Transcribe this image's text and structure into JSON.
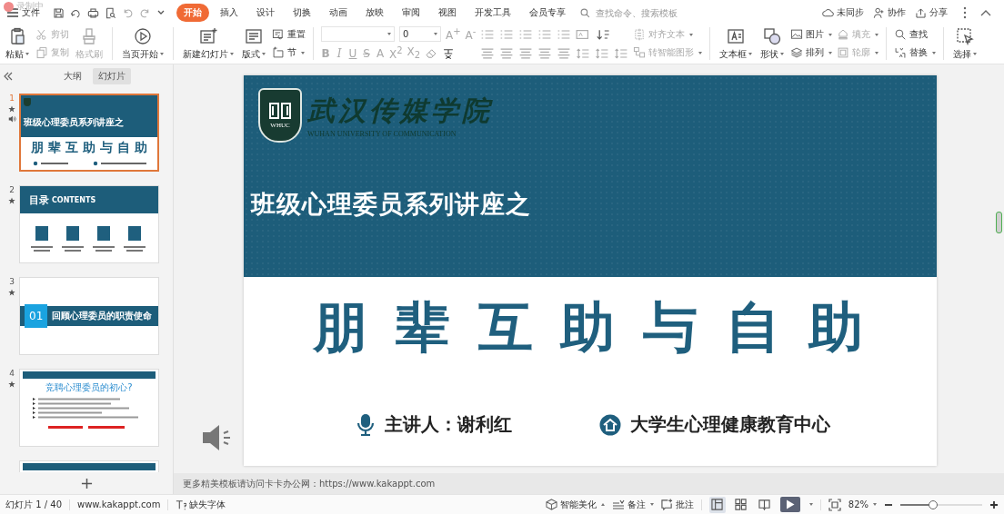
{
  "recording_badge": "录制中",
  "menu": {
    "file": "文件",
    "tabs": [
      {
        "label": "开始",
        "selected": true
      },
      {
        "label": "插入",
        "selected": false
      },
      {
        "label": "设计",
        "selected": false
      },
      {
        "label": "切换",
        "selected": false
      },
      {
        "label": "动画",
        "selected": false
      },
      {
        "label": "放映",
        "selected": false
      },
      {
        "label": "审阅",
        "selected": false
      },
      {
        "label": "视图",
        "selected": false
      },
      {
        "label": "开发工具",
        "selected": false
      },
      {
        "label": "会员专享",
        "selected": false
      }
    ],
    "search": {
      "placeholder": "查找命令、搜索模板"
    },
    "actions": [
      "未同步",
      "协作",
      "分享"
    ]
  },
  "ribbon": {
    "items": [
      {
        "kind": "large",
        "label": "粘贴",
        "disabled": false,
        "dropdown": true
      },
      {
        "kind": "stack",
        "items": [
          {
            "label": "剪切",
            "disabled": true,
            "dropdown": false
          },
          {
            "label": "复制",
            "disabled": true,
            "dropdown": false
          }
        ]
      },
      {
        "kind": "large",
        "label": "格式刷",
        "disabled": true,
        "dropdown": false
      },
      {
        "kind": "divider"
      },
      {
        "kind": "large",
        "label": "当页开始",
        "disabled": false,
        "dropdown": true
      },
      {
        "kind": "divider"
      },
      {
        "kind": "large",
        "label": "新建幻灯片",
        "disabled": false,
        "dropdown": true
      },
      {
        "kind": "large",
        "label": "版式",
        "disabled": false,
        "dropdown": true
      },
      {
        "kind": "stack",
        "items": [
          {
            "label": "重置",
            "disabled": false,
            "dropdown": false
          },
          {
            "label": "节",
            "disabled": false,
            "dropdown": true
          }
        ]
      },
      {
        "kind": "divider"
      },
      {
        "kind": "font",
        "size": "0",
        "size_buttons": [
          "A$^{+}$",
          "A$^{-}$"
        ],
        "format_buttons": [
          "B",
          "I",
          "U",
          "S",
          "A",
          "X$^{2}$",
          "X$_{2}$"
        ]
      },
      {
        "kind": "paragraph"
      },
      {
        "kind": "stack",
        "items": [
          {
            "label": "对齐文本",
            "disabled": true,
            "dropdown": true
          },
          {
            "label": "转智能图形",
            "disabled": true,
            "dropdown": true
          }
        ]
      },
      {
        "kind": "divider"
      },
      {
        "kind": "large",
        "label": "文本框",
        "disabled": false,
        "dropdown": true
      },
      {
        "kind": "large",
        "label": "形状",
        "disabled": false,
        "dropdown": true
      },
      {
        "kind": "stack",
        "items": [
          {
            "label": "图片",
            "disabled": false,
            "dropdown": true
          },
          {
            "label": "排列",
            "disabled": false,
            "dropdown": true
          }
        ]
      },
      {
        "kind": "stack",
        "items": [
          {
            "label": "填充",
            "disabled": true,
            "dropdown": true
          },
          {
            "label": "轮廓",
            "disabled": true,
            "dropdown": true
          }
        ]
      },
      {
        "kind": "divider"
      },
      {
        "kind": "stack",
        "items": [
          {
            "label": "查找",
            "disabled": false,
            "dropdown": false
          },
          {
            "label": "替换",
            "disabled": false,
            "dropdown": true
          }
        ]
      },
      {
        "kind": "divider"
      },
      {
        "kind": "large",
        "label": "选择",
        "disabled": false,
        "dropdown": true
      }
    ]
  },
  "panel": {
    "tabs": [
      {
        "label": "大纲",
        "selected": false
      },
      {
        "label": "幻灯片",
        "selected": true
      }
    ],
    "slides": [
      {
        "number": "1",
        "selected": true,
        "starred": true,
        "audio": true,
        "kind": "title",
        "title": "班级心理委员系列讲座之",
        "heading": "朋 辈 互 助 与 自 助"
      },
      {
        "number": "2",
        "selected": false,
        "starred": true,
        "audio": false,
        "kind": "contents",
        "title": "目录",
        "subtitle": "CONTENTS"
      },
      {
        "number": "3",
        "selected": false,
        "starred": true,
        "audio": false,
        "kind": "section",
        "badge": "01",
        "title": "回顾心理委员的职责使命"
      },
      {
        "number": "4",
        "selected": false,
        "starred": true,
        "audio": false,
        "kind": "content",
        "heading": "竞聘心理委员的初心?"
      },
      {
        "selected": false,
        "starred": false,
        "audio": false,
        "kind": "partial"
      }
    ]
  },
  "slide": {
    "logo": {
      "badge": "WHUC",
      "name": "武汉传媒学院",
      "subtitle": "WUHAN UNIVERSITY OF COMMUNICATION"
    },
    "title": "班级心理委员系列讲座之",
    "heading": "朋 辈 互 助 与 自 助",
    "presenter": "主讲人：谢利红",
    "organization": "大学生心理健康教育中心",
    "audio": true
  },
  "notes": "更多精美模板请访问卡卡办公网：https://www.kakappt.com",
  "status": {
    "slide_counter": "幻灯片 1 / 40",
    "website": "www.kakappt.com",
    "missing_font": "缺失字体",
    "beautify": "智能美化",
    "notes": "备注",
    "comments": "批注",
    "views": [
      {
        "selected": true
      },
      {
        "selected": false
      },
      {
        "selected": false
      }
    ],
    "zoom": {
      "value": "82%",
      "level": 0.4
    }
  }
}
